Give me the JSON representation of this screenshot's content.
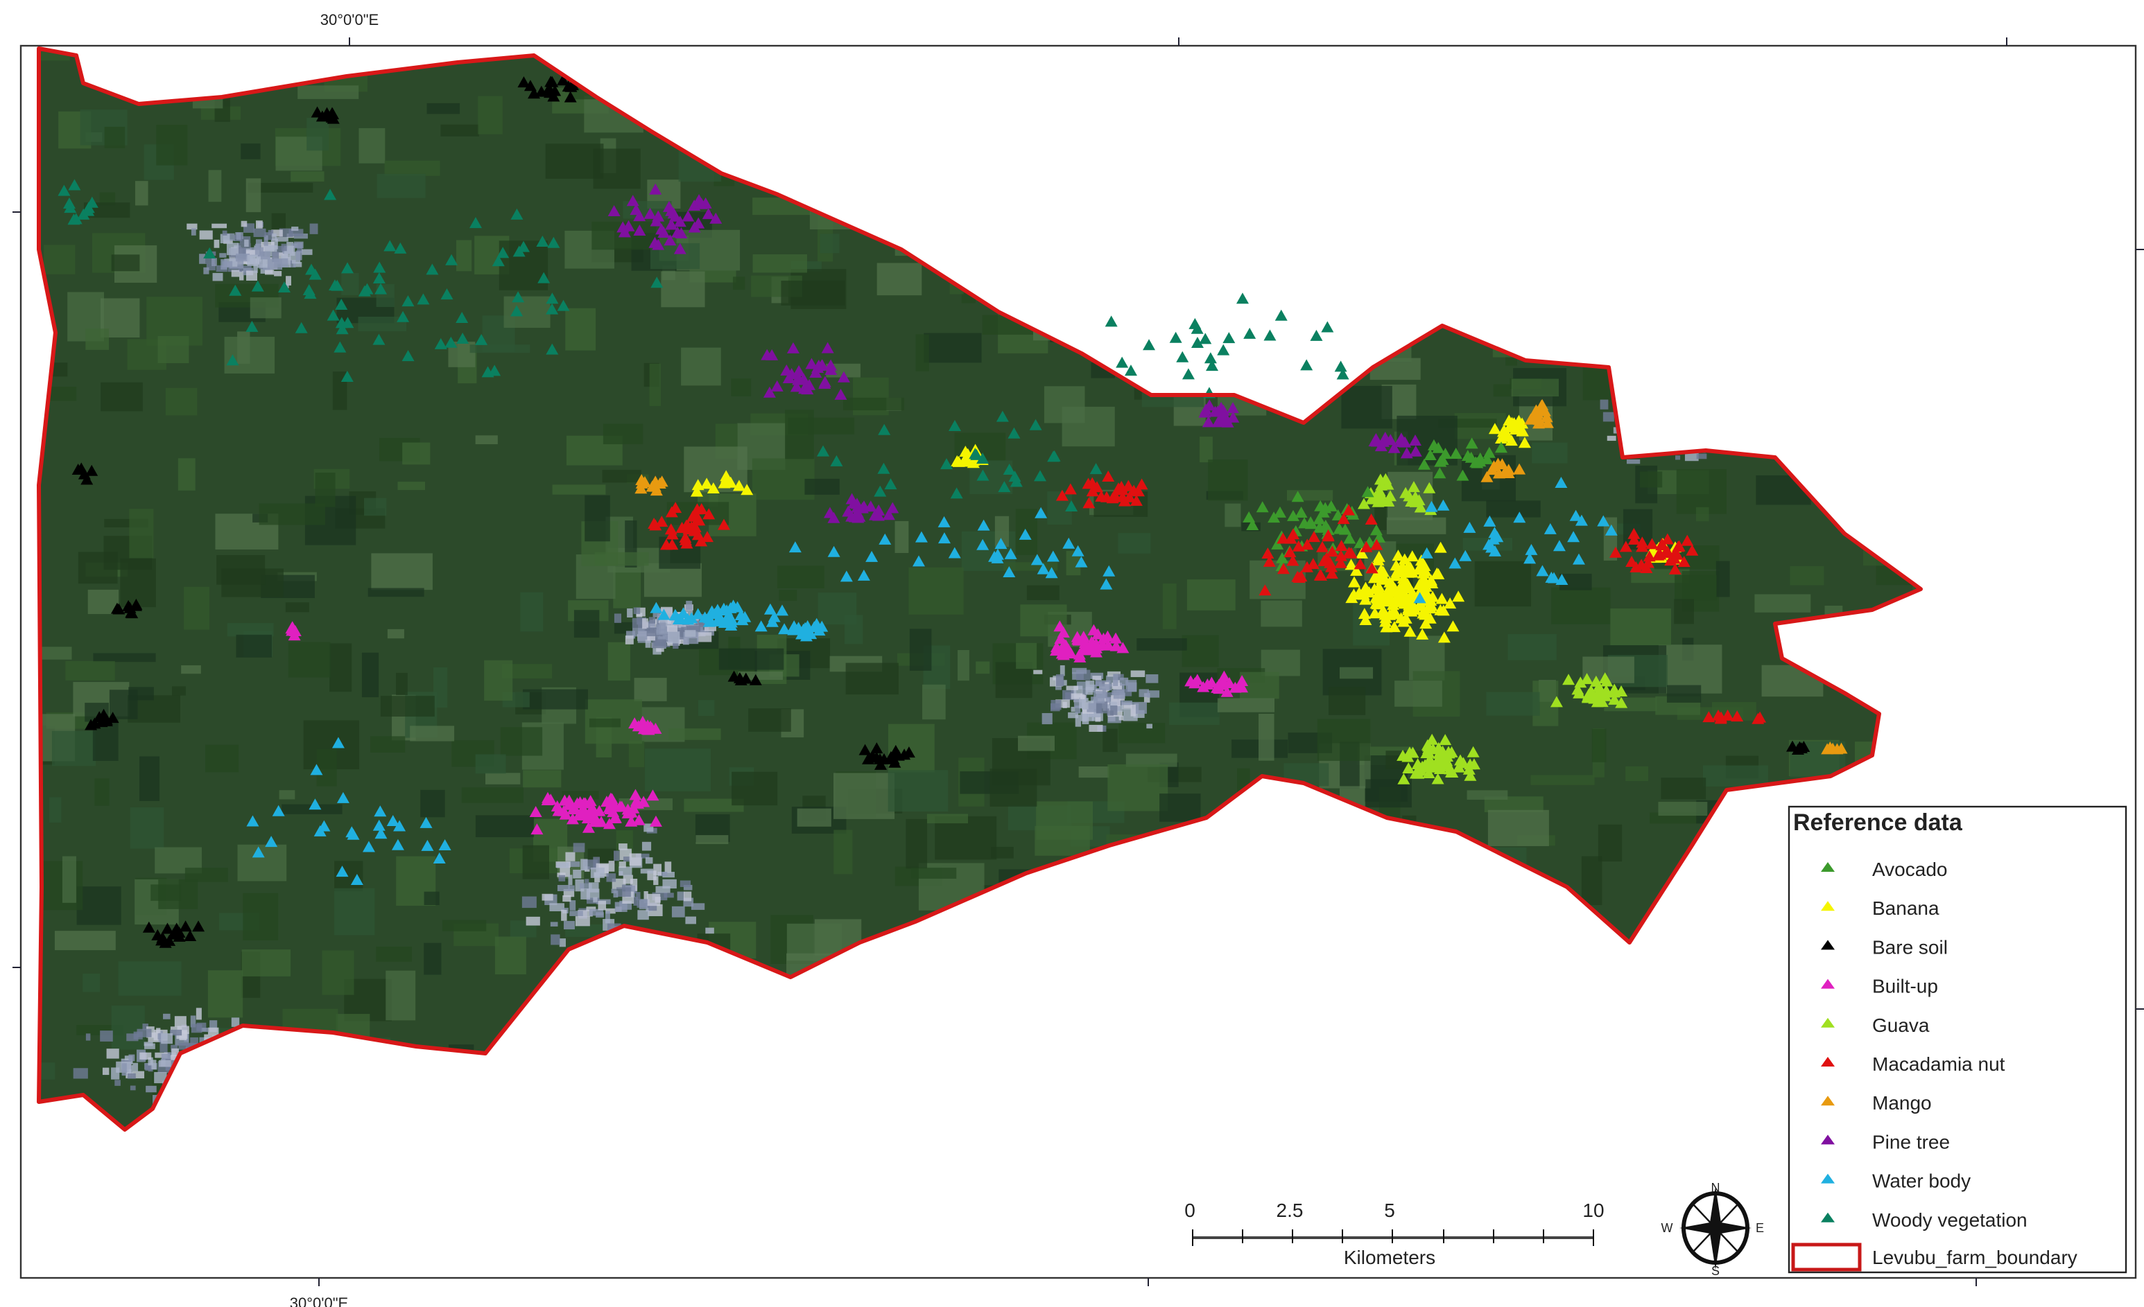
{
  "graticule": {
    "top_label": "30°0'0\"E",
    "bottom_label": "30°0'0\"E"
  },
  "legend": {
    "title": "Reference data",
    "classes": [
      {
        "label": "Avocado",
        "color": "#3c9a2c"
      },
      {
        "label": "Banana",
        "color": "#f5f500"
      },
      {
        "label": "Bare soil",
        "color": "#000000"
      },
      {
        "label": "Built-up",
        "color": "#e020c0"
      },
      {
        "label": "Guava",
        "color": "#a0e020"
      },
      {
        "label": "Macadamia nut",
        "color": "#e01010"
      },
      {
        "label": "Mango",
        "color": "#e89a10"
      },
      {
        "label": "Pine tree",
        "color": "#8010a0"
      },
      {
        "label": "Water body",
        "color": "#20b0e0"
      },
      {
        "label": "Woody vegetation",
        "color": "#0a8060"
      }
    ],
    "boundary": {
      "label": "Levubu_farm_boundary",
      "color": "#d01010"
    }
  },
  "scale_bar": {
    "labels": [
      "0",
      "2.5",
      "5",
      "10"
    ],
    "unit": "Kilometers"
  },
  "north_arrow": {
    "n": "N",
    "s": "S",
    "e": "E",
    "w": "W"
  }
}
